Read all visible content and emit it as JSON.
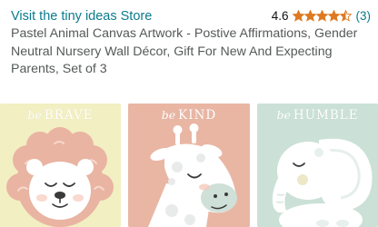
{
  "store": {
    "link_text": "Visit the tiny ideas Store"
  },
  "rating": {
    "value": "4.6",
    "stars": 4.5,
    "reviews": "(3)",
    "star_color": "#de7921"
  },
  "product": {
    "title": "Pastel Animal Canvas Artwork - Postive Affirmations, Gender Neutral Nursery Wall Décor, Gift For New And Expecting Parents, Set of 3"
  },
  "gallery": {
    "panels": [
      {
        "be": "be",
        "word": "BRAVE",
        "background": "#f2efc2",
        "animal": "lion-icon"
      },
      {
        "be": "be",
        "word": "KIND",
        "background": "#e9b6a4",
        "animal": "giraffe-icon"
      },
      {
        "be": "be",
        "word": "HUMBLE",
        "background": "#cbe1d7",
        "animal": "elephant-icon"
      }
    ]
  }
}
